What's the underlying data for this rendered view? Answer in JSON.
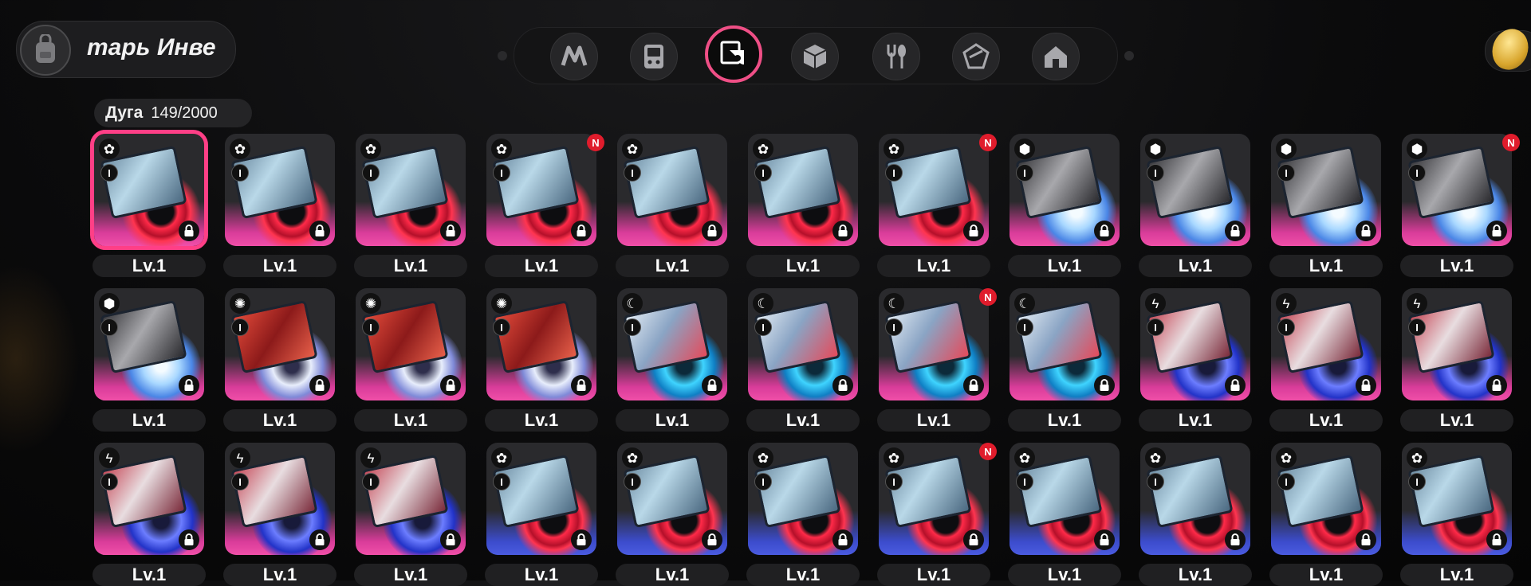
{
  "header": {
    "title": "тарь Инве"
  },
  "nav": {
    "items": [
      {
        "icon": "n-logo-icon"
      },
      {
        "icon": "handheld-console-icon"
      },
      {
        "icon": "drive-disc-icon",
        "active": true
      },
      {
        "icon": "cube-icon"
      },
      {
        "icon": "fork-spoon-icon"
      },
      {
        "icon": "bangboo-icon"
      },
      {
        "icon": "home-icon"
      }
    ],
    "accent": "#ef4f86"
  },
  "counter": {
    "label": "Дуга",
    "value": "149/2000"
  },
  "currency": {
    "icon": "gold-coin-icon"
  },
  "grid": {
    "rows": [
      [
        {
          "type": "flower",
          "style": "red",
          "level": "Lv.1",
          "rank": "I",
          "new": false,
          "selected": true
        },
        {
          "type": "flower",
          "style": "red",
          "level": "Lv.1",
          "rank": "I",
          "new": false
        },
        {
          "type": "flower",
          "style": "red",
          "level": "Lv.1",
          "rank": "I",
          "new": false
        },
        {
          "type": "flower",
          "style": "red",
          "level": "Lv.1",
          "rank": "I",
          "new": true
        },
        {
          "type": "flower",
          "style": "red",
          "level": "Lv.1",
          "rank": "I",
          "new": false
        },
        {
          "type": "flower",
          "style": "red",
          "level": "Lv.1",
          "rank": "I",
          "new": false
        },
        {
          "type": "flower",
          "style": "red",
          "level": "Lv.1",
          "rank": "I",
          "new": true
        },
        {
          "type": "cube",
          "style": "ice",
          "level": "Lv.1",
          "rank": "I",
          "new": false
        },
        {
          "type": "cube",
          "style": "ice",
          "level": "Lv.1",
          "rank": "I",
          "new": false
        },
        {
          "type": "cube",
          "style": "ice",
          "level": "Lv.1",
          "rank": "I",
          "new": false
        },
        {
          "type": "cube",
          "style": "ice",
          "level": "Lv.1",
          "rank": "I",
          "new": true
        }
      ],
      [
        {
          "type": "cube",
          "style": "ice",
          "level": "Lv.1",
          "rank": "I",
          "new": false
        },
        {
          "type": "swirl",
          "style": "white",
          "level": "Lv.1",
          "rank": "I",
          "new": false
        },
        {
          "type": "swirl",
          "style": "white",
          "level": "Lv.1",
          "rank": "I",
          "new": false
        },
        {
          "type": "swirl",
          "style": "white",
          "level": "Lv.1",
          "rank": "I",
          "new": false
        },
        {
          "type": "wave",
          "style": "cyan",
          "level": "Lv.1",
          "rank": "I",
          "new": false
        },
        {
          "type": "wave",
          "style": "cyan",
          "level": "Lv.1",
          "rank": "I",
          "new": false
        },
        {
          "type": "wave",
          "style": "cyan",
          "level": "Lv.1",
          "rank": "I",
          "new": true
        },
        {
          "type": "wave",
          "style": "cyan",
          "level": "Lv.1",
          "rank": "I",
          "new": false
        },
        {
          "type": "bolt",
          "style": "elec",
          "level": "Lv.1",
          "rank": "I",
          "new": false
        },
        {
          "type": "bolt",
          "style": "elec",
          "level": "Lv.1",
          "rank": "I",
          "new": false
        },
        {
          "type": "bolt",
          "style": "elec",
          "level": "Lv.1",
          "rank": "I",
          "new": false
        }
      ],
      [
        {
          "type": "bolt",
          "style": "elec",
          "level": "Lv.1",
          "rank": "I",
          "new": false
        },
        {
          "type": "bolt",
          "style": "elec",
          "level": "Lv.1",
          "rank": "I",
          "new": false
        },
        {
          "type": "bolt",
          "style": "elec",
          "level": "Lv.1",
          "rank": "I",
          "new": false
        },
        {
          "type": "flower",
          "style": "red",
          "color": "blue",
          "level": "Lv.1",
          "rank": "I",
          "new": false
        },
        {
          "type": "flower",
          "style": "red",
          "color": "blue",
          "level": "Lv.1",
          "rank": "I",
          "new": false
        },
        {
          "type": "flower",
          "style": "red",
          "color": "blue",
          "level": "Lv.1",
          "rank": "I",
          "new": false
        },
        {
          "type": "flower",
          "style": "red",
          "color": "blue",
          "level": "Lv.1",
          "rank": "I",
          "new": true
        },
        {
          "type": "flower",
          "style": "red",
          "color": "blue",
          "level": "Lv.1",
          "rank": "I",
          "new": false
        },
        {
          "type": "flower",
          "style": "red",
          "color": "blue",
          "level": "Lv.1",
          "rank": "I",
          "new": false
        },
        {
          "type": "flower",
          "style": "red",
          "color": "blue",
          "level": "Lv.1",
          "rank": "I",
          "new": false
        },
        {
          "type": "flower",
          "style": "red",
          "color": "blue",
          "level": "Lv.1",
          "rank": "I",
          "new": false
        }
      ]
    ],
    "new_label": "N"
  }
}
